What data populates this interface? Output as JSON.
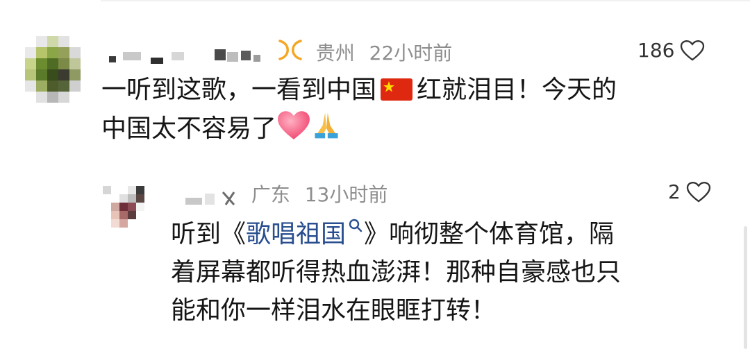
{
  "comments": [
    {
      "username": "",
      "location": "贵州",
      "time": "22小时前",
      "likes": "186",
      "text_line1": "一听到这歌，一看到中国",
      "text_line1_after_flag": "红就泪目！今天的",
      "text_line2": "中国太不容易了",
      "emojis": [
        "heart-emoji",
        "pray-emoji",
        "china-flag-emoji"
      ]
    }
  ],
  "reply": {
    "username": "",
    "location": "广东",
    "time": "13小时前",
    "likes": "2",
    "prefix": "听到《",
    "topic": "歌唱祖国",
    "suffix": "》响彻整个体育馆，隔",
    "line2": "着屏幕都听得热血澎湃！那种自豪感也只",
    "line3": "能和你一样泪水在眼眶打转！"
  },
  "icons": [
    "heart-outline-icon",
    "badge-icon",
    "search-icon"
  ],
  "colors": {
    "topic_link": "#284e8f",
    "meta_gray": "#8d8d8d",
    "badge_orange": "#f5a623",
    "flag_red": "#de2910"
  }
}
